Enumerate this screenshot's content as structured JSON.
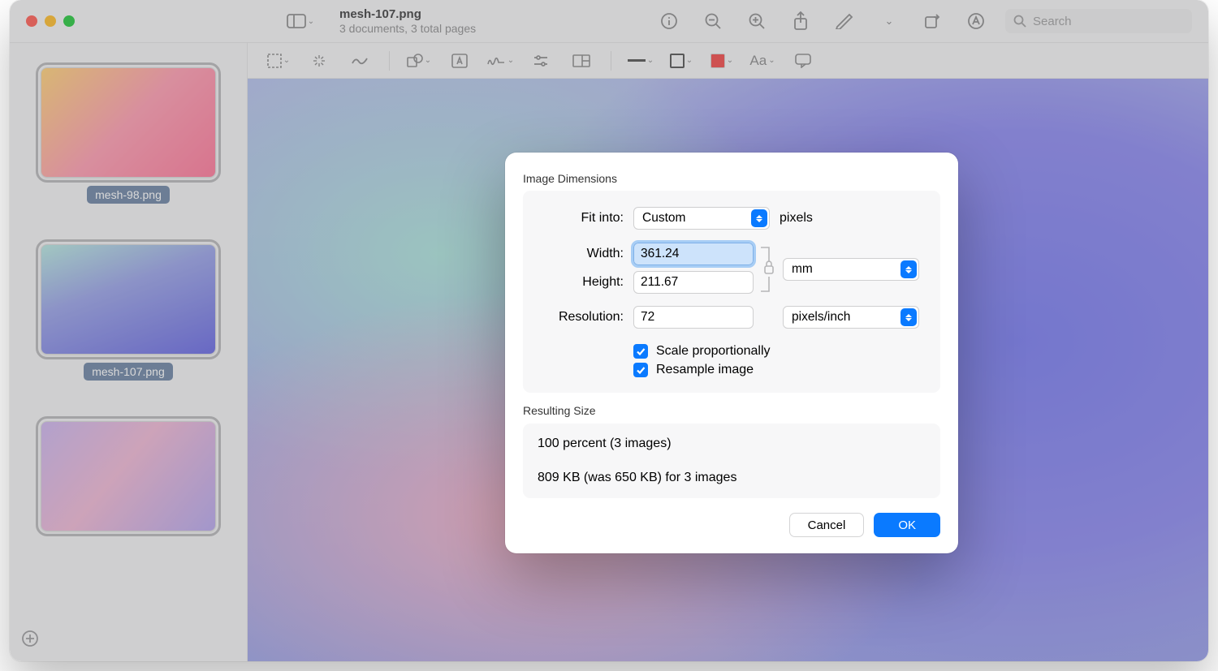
{
  "header": {
    "filename": "mesh-107.png",
    "subtitle": "3 documents, 3 total pages",
    "search_placeholder": "Search"
  },
  "sidebar": {
    "thumbs": [
      {
        "label": "mesh-98.png"
      },
      {
        "label": "mesh-107.png"
      },
      {
        "label": ""
      }
    ]
  },
  "dialog": {
    "section1_title": "Image Dimensions",
    "fit_label": "Fit into:",
    "fit_value": "Custom",
    "fit_unit_label": "pixels",
    "width_label": "Width:",
    "width_value": "361.24",
    "height_label": "Height:",
    "height_value": "211.67",
    "dim_unit_value": "mm",
    "resolution_label": "Resolution:",
    "resolution_value": "72",
    "resolution_unit_value": "pixels/inch",
    "scale_label": "Scale proportionally",
    "resample_label": "Resample image",
    "section2_title": "Resulting Size",
    "result_line1": "100 percent (3 images)",
    "result_line2": "809 KB (was 650 KB) for 3 images",
    "cancel": "Cancel",
    "ok": "OK"
  },
  "toolbar2": {
    "text_label": "Aa"
  }
}
